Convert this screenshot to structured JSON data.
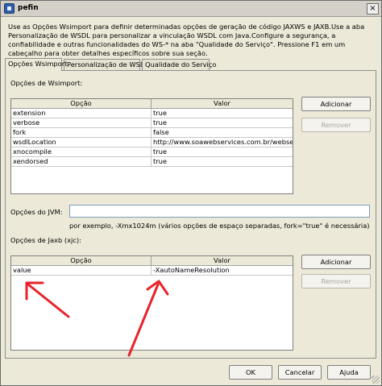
{
  "window": {
    "title": "pefin",
    "close_glyph": "×"
  },
  "description": "Use as Opções Wsimport para definir determinadas opções de geração de código JAXWS e JAXB.Use a aba Personalização de WSDL para personalizar a vinculação WSDL com Java.Configure a segurança, a confiabilidade e outras funcionalidades do WS-* na aba \"Qualidade do Serviço\". Pressione F1 em um cabeçalho para obter detalhes específicos sobre sua seção.",
  "tabs": [
    {
      "label": "Opções Wsimport",
      "active": true
    },
    {
      "label": "Personalização de WSDL",
      "active": false
    },
    {
      "label": "Qualidade do Serviço",
      "active": false
    }
  ],
  "wsimport": {
    "label": "Opções de Wsimport:",
    "columns": [
      "Opção",
      "Valor"
    ],
    "rows": [
      [
        "extension",
        "true"
      ],
      [
        "verbose",
        "true"
      ],
      [
        "fork",
        "false"
      ],
      [
        "wsdlLocation",
        "http://www.soawebservices.com.br/webserv..."
      ],
      [
        "xnocompile",
        "true"
      ],
      [
        "xendorsed",
        "true"
      ]
    ],
    "add_label": "Adicionar",
    "remove_label": "Remover"
  },
  "jvm": {
    "label": "Opções do JVM:",
    "value": "",
    "hint": "por exemplo, -Xmx1024m (vários opções de espaço separadas, fork=\"true\" é necessária)"
  },
  "jaxb": {
    "label": "Opções de Jaxb (xjc):",
    "columns": [
      "Opção",
      "Valor"
    ],
    "rows": [
      [
        "value",
        "-XautoNameResolution"
      ]
    ],
    "add_label": "Adicionar",
    "remove_label": "Remover"
  },
  "footer": {
    "ok_label": "OK",
    "cancel_label": "Cancelar",
    "help_label": "Ajuda"
  },
  "colors": {
    "dialog_bg": "#ece9d8",
    "annotation_arrow": "#e8232a"
  }
}
